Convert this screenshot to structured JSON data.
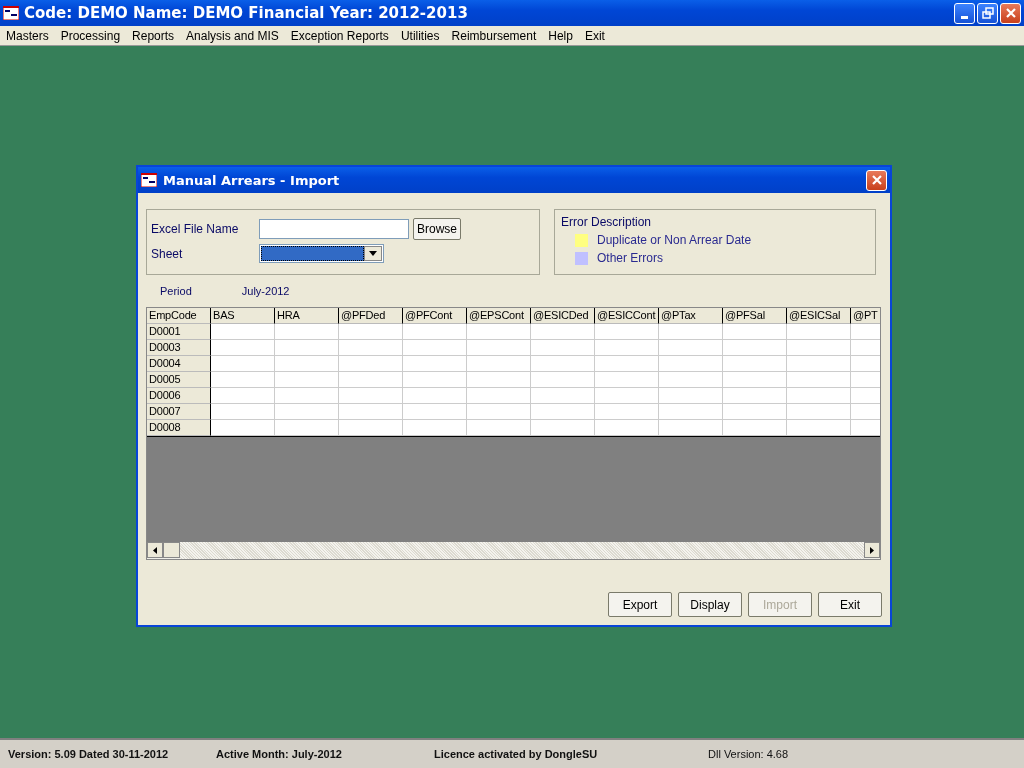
{
  "window": {
    "title": "Code: DEMO Name: DEMO Financial Year: 2012-2013"
  },
  "menu": [
    "Masters",
    "Processing",
    "Reports",
    "Analysis and MIS",
    "Exception Reports",
    "Utilities",
    "Reimbursement",
    "Help",
    "Exit"
  ],
  "dialog": {
    "title": "Manual Arrears - Import",
    "file_group": {
      "excel_label": "Excel File Name",
      "browse": "Browse",
      "sheet_label": "Sheet"
    },
    "error_legend": {
      "title": "Error Description",
      "items": [
        {
          "label": "Duplicate or Non Arrear Date",
          "color": "#ffff80"
        },
        {
          "label": "Other Errors",
          "color": "#c0c0ff"
        }
      ]
    },
    "period": {
      "label": "Period",
      "value": "July-2012"
    },
    "table": {
      "columns": [
        "EmpCode",
        "BAS",
        "HRA",
        "@PFDed",
        "@PFCont",
        "@EPSCont",
        "@ESICDed",
        "@ESICCont",
        "@PTax",
        "@PFSal",
        "@ESICSal",
        "@PT"
      ],
      "rows": [
        "D0001",
        "D0003",
        "D0004",
        "D0005",
        "D0006",
        "D0007",
        "D0008"
      ]
    },
    "buttons": [
      {
        "label": "Export",
        "disabled": false
      },
      {
        "label": "Display",
        "disabled": false
      },
      {
        "label": "Import",
        "disabled": true
      },
      {
        "label": "Exit",
        "disabled": false
      }
    ]
  },
  "status_bar": [
    {
      "text": "Version: 5.09 Dated 30-11-2012",
      "bold": true
    },
    {
      "text": "Active Month: July-2012",
      "bold": true
    },
    {
      "text": "Licence activated by DongleSU",
      "bold": true
    },
    {
      "text": "Dll Version: 4.68",
      "bold": false
    }
  ]
}
